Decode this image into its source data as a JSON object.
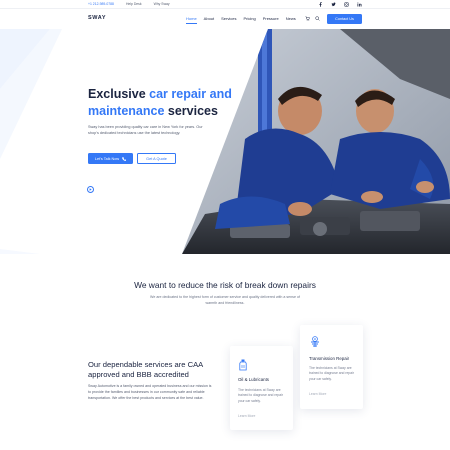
{
  "topbar": {
    "phone": "+1 212-989-0788",
    "help": "Help Desk",
    "why": "Why Sway"
  },
  "brand": {
    "logo": "SWAY"
  },
  "nav": {
    "items": [
      "Home",
      "About",
      "Services",
      "Pricing",
      "Pressure",
      "News"
    ],
    "cta": "Contact Us"
  },
  "hero": {
    "title_line1_plain": "Exclusive ",
    "title_line1_accent": "car repair",
    "title_line2_accent": "and",
    "title_line2_accent2": "maintenance",
    "title_line2_plain": " services",
    "text": "Sway has been providing quality car care in New York for years. Our shop's dedicated technicians use the latest technology.",
    "primary_button": "Let's Talk Now",
    "secondary_button": "Get A Quote"
  },
  "risk": {
    "title": "We want to reduce the risk of break down repairs",
    "text": "We are dedicated to the highest form of customer service and quality delivered with a sense of warmth and friendliness."
  },
  "services": {
    "title": "Our dependable services are CAA approved and BBB accredited",
    "text": "Sway Automotive is a family owned and operated business and our mission is to provide the families and businesses in our community safe and reliable transportation. We offer the best products and services at the best value.",
    "cards": [
      {
        "icon": "oil-bottle-icon",
        "title": "Oil & Lubricants",
        "text": "The technicians at Sway are trained to diagnose and repair your car safely.",
        "link": "Learn More"
      },
      {
        "icon": "transmission-icon",
        "title": "Transmission Repair",
        "text": "The technicians at Sway are trained to diagnose and repair your car safely.",
        "link": "Learn More"
      }
    ]
  },
  "colors": {
    "accent": "#3478f6",
    "dark": "#1b2440",
    "muted": "#555d70"
  }
}
